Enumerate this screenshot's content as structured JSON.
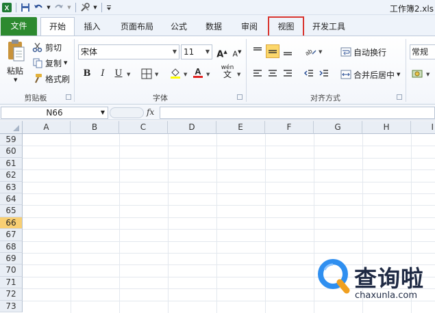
{
  "window": {
    "title": "工作簿2.xls"
  },
  "qat": {
    "icons": [
      "excel-logo-icon",
      "save-icon",
      "undo-icon",
      "redo-icon",
      "tools-icon",
      "customize-icon"
    ]
  },
  "tabs": [
    {
      "label": "文件",
      "name": "tab-file"
    },
    {
      "label": "开始",
      "name": "tab-home"
    },
    {
      "label": "插入",
      "name": "tab-insert"
    },
    {
      "label": "页面布局",
      "name": "tab-page-layout"
    },
    {
      "label": "公式",
      "name": "tab-formulas"
    },
    {
      "label": "数据",
      "name": "tab-data"
    },
    {
      "label": "审阅",
      "name": "tab-review"
    },
    {
      "label": "视图",
      "name": "tab-view"
    },
    {
      "label": "开发工具",
      "name": "tab-developer"
    }
  ],
  "clipboard": {
    "paste": "粘贴",
    "cut": "剪切",
    "copy": "复制",
    "format_painter": "格式刷",
    "group_label": "剪贴板"
  },
  "font": {
    "name": "宋体",
    "size": "11",
    "bold": "B",
    "italic": "I",
    "underline": "U",
    "wen": "wén",
    "group_label": "字体"
  },
  "alignment": {
    "wrap_text": "自动换行",
    "merge_center": "合并后居中",
    "group_label": "对齐方式"
  },
  "number": {
    "format": "常规"
  },
  "formula_bar": {
    "name_box": "N66",
    "fx": "fx",
    "value": ""
  },
  "grid": {
    "columns": [
      "A",
      "B",
      "C",
      "D",
      "E",
      "F",
      "G",
      "H",
      "I"
    ],
    "rows": [
      "59",
      "60",
      "61",
      "62",
      "63",
      "64",
      "65",
      "66",
      "67",
      "68",
      "69",
      "70",
      "71",
      "72",
      "73"
    ],
    "selected_row": "66"
  },
  "watermark": {
    "text": "查询啦",
    "url": "chaxunla.com"
  },
  "colors": {
    "file_tab": "#2d8a2f",
    "highlight": "#d9352f",
    "selected_row": "#f8cf73",
    "header_bg": "#e9eef5"
  }
}
